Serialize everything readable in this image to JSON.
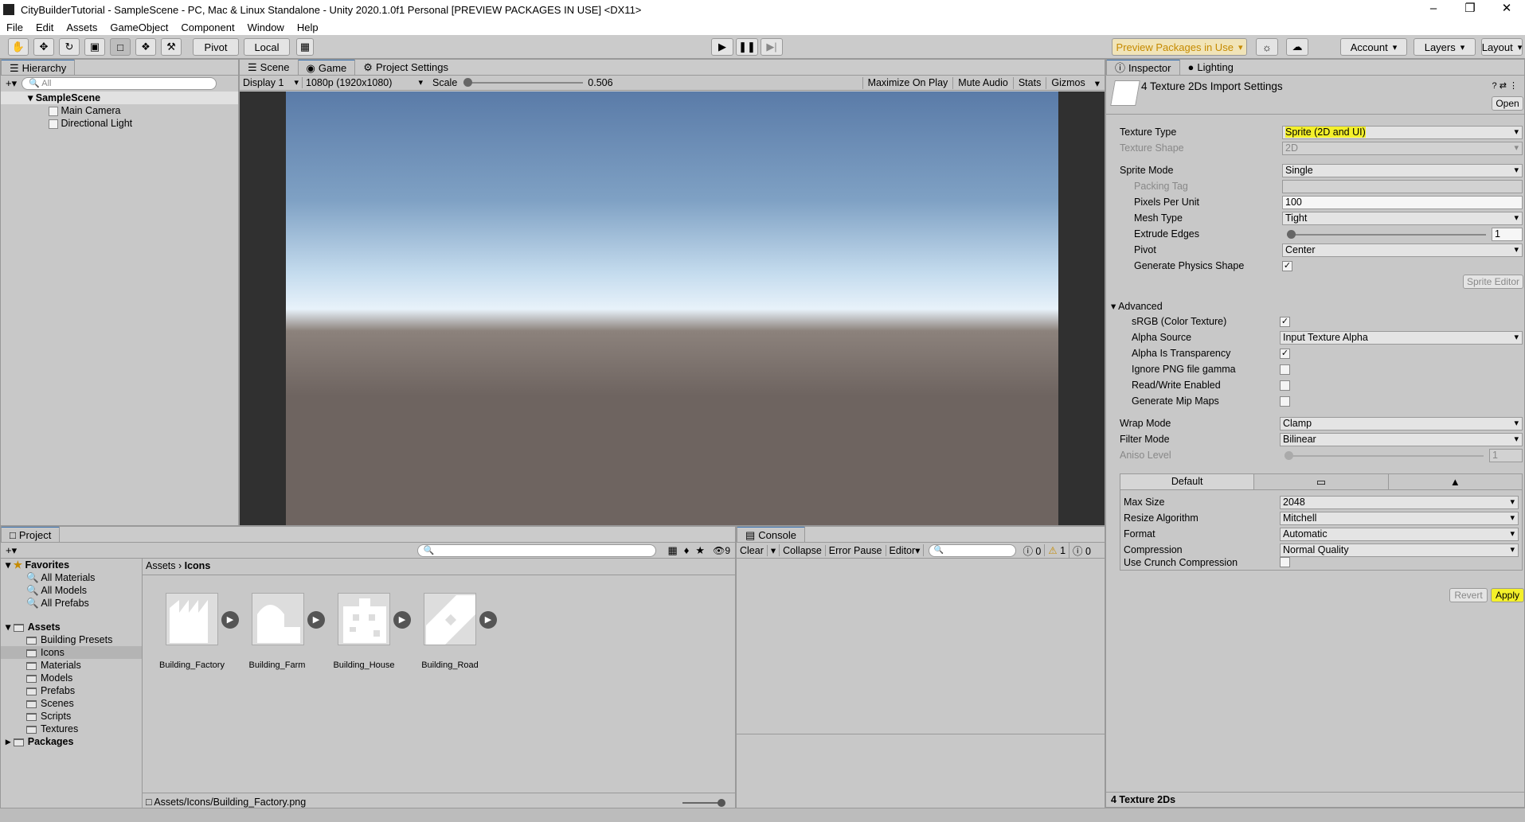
{
  "window": {
    "title": "CityBuilderTutorial - SampleScene - PC, Mac & Linux Standalone - Unity 2020.1.0f1 Personal [PREVIEW PACKAGES IN USE] <DX11>"
  },
  "menu": [
    "File",
    "Edit",
    "Assets",
    "GameObject",
    "Component",
    "Window",
    "Help"
  ],
  "toolbar": {
    "pivot": "Pivot",
    "local": "Local",
    "preview_packages": "Preview Packages in Use",
    "account": "Account",
    "layers": "Layers",
    "layout": "Layout"
  },
  "hierarchy": {
    "tab": "Hierarchy",
    "search_placeholder": "All",
    "scene": "SampleScene",
    "objects": [
      "Main Camera",
      "Directional Light"
    ]
  },
  "game": {
    "tabs": [
      "Scene",
      "Game",
      "Project Settings"
    ],
    "display": "Display 1",
    "resolution": "1080p (1920x1080)",
    "scale_label": "Scale",
    "scale_value": "0.506",
    "scale_fraction": 0.0,
    "buttons": [
      "Maximize On Play",
      "Mute Audio",
      "Stats",
      "Gizmos"
    ],
    "colors": {
      "sky_top": "#5a7ba8",
      "horizon": "#e8f2fa",
      "ground": "#6e6460"
    }
  },
  "inspector": {
    "tabs": [
      "Inspector",
      "Lighting"
    ],
    "title": "4 Texture 2Ds Import Settings",
    "open": "Open",
    "texture_type": {
      "label": "Texture Type",
      "value": "Sprite (2D and UI)"
    },
    "texture_shape": {
      "label": "Texture Shape",
      "value": "2D"
    },
    "sprite_mode": {
      "label": "Sprite Mode",
      "value": "Single"
    },
    "packing_tag": {
      "label": "Packing Tag",
      "value": ""
    },
    "pixels_per_unit": {
      "label": "Pixels Per Unit",
      "value": "100"
    },
    "mesh_type": {
      "label": "Mesh Type",
      "value": "Tight"
    },
    "extrude_edges": {
      "label": "Extrude Edges",
      "value": "1"
    },
    "pivot": {
      "label": "Pivot",
      "value": "Center"
    },
    "gen_physics": {
      "label": "Generate Physics Shape",
      "checked": true
    },
    "sprite_editor": "Sprite Editor",
    "advanced": "Advanced",
    "srgb": {
      "label": "sRGB (Color Texture)",
      "checked": true
    },
    "alpha_source": {
      "label": "Alpha Source",
      "value": "Input Texture Alpha"
    },
    "alpha_transparency": {
      "label": "Alpha Is Transparency",
      "checked": true
    },
    "ignore_png": {
      "label": "Ignore PNG file gamma",
      "checked": false
    },
    "read_write": {
      "label": "Read/Write Enabled",
      "checked": false
    },
    "mip_maps": {
      "label": "Generate Mip Maps",
      "checked": false
    },
    "wrap_mode": {
      "label": "Wrap Mode",
      "value": "Clamp"
    },
    "filter_mode": {
      "label": "Filter Mode",
      "value": "Bilinear"
    },
    "aniso_level": {
      "label": "Aniso Level",
      "value": "1"
    },
    "platform_default": "Default",
    "max_size": {
      "label": "Max Size",
      "value": "2048"
    },
    "resize_algorithm": {
      "label": "Resize Algorithm",
      "value": "Mitchell"
    },
    "format": {
      "label": "Format",
      "value": "Automatic"
    },
    "compression": {
      "label": "Compression",
      "value": "Normal Quality"
    },
    "crunch": {
      "label": "Use Crunch Compression",
      "checked": false
    },
    "revert": "Revert",
    "apply": "Apply",
    "footer": "4 Texture 2Ds",
    "highlight_color": "#f4f02a"
  },
  "project": {
    "tab": "Project",
    "hidden_count": "9",
    "favorites": "Favorites",
    "fav_items": [
      "All Materials",
      "All Models",
      "All Prefabs"
    ],
    "assets": "Assets",
    "folders": [
      "Building Presets",
      "Icons",
      "Materials",
      "Models",
      "Prefabs",
      "Scenes",
      "Scripts",
      "Textures"
    ],
    "packages": "Packages",
    "breadcrumb": [
      "Assets",
      "Icons"
    ],
    "items": [
      "Building_Factory",
      "Building_Farm",
      "Building_House",
      "Building_Road"
    ],
    "status_path": "Assets/Icons/Building_Factory.png"
  },
  "console": {
    "tab": "Console",
    "buttons": [
      "Clear",
      "Collapse",
      "Error Pause",
      "Editor"
    ],
    "errors": "0",
    "warnings": "1",
    "messages": "0"
  }
}
